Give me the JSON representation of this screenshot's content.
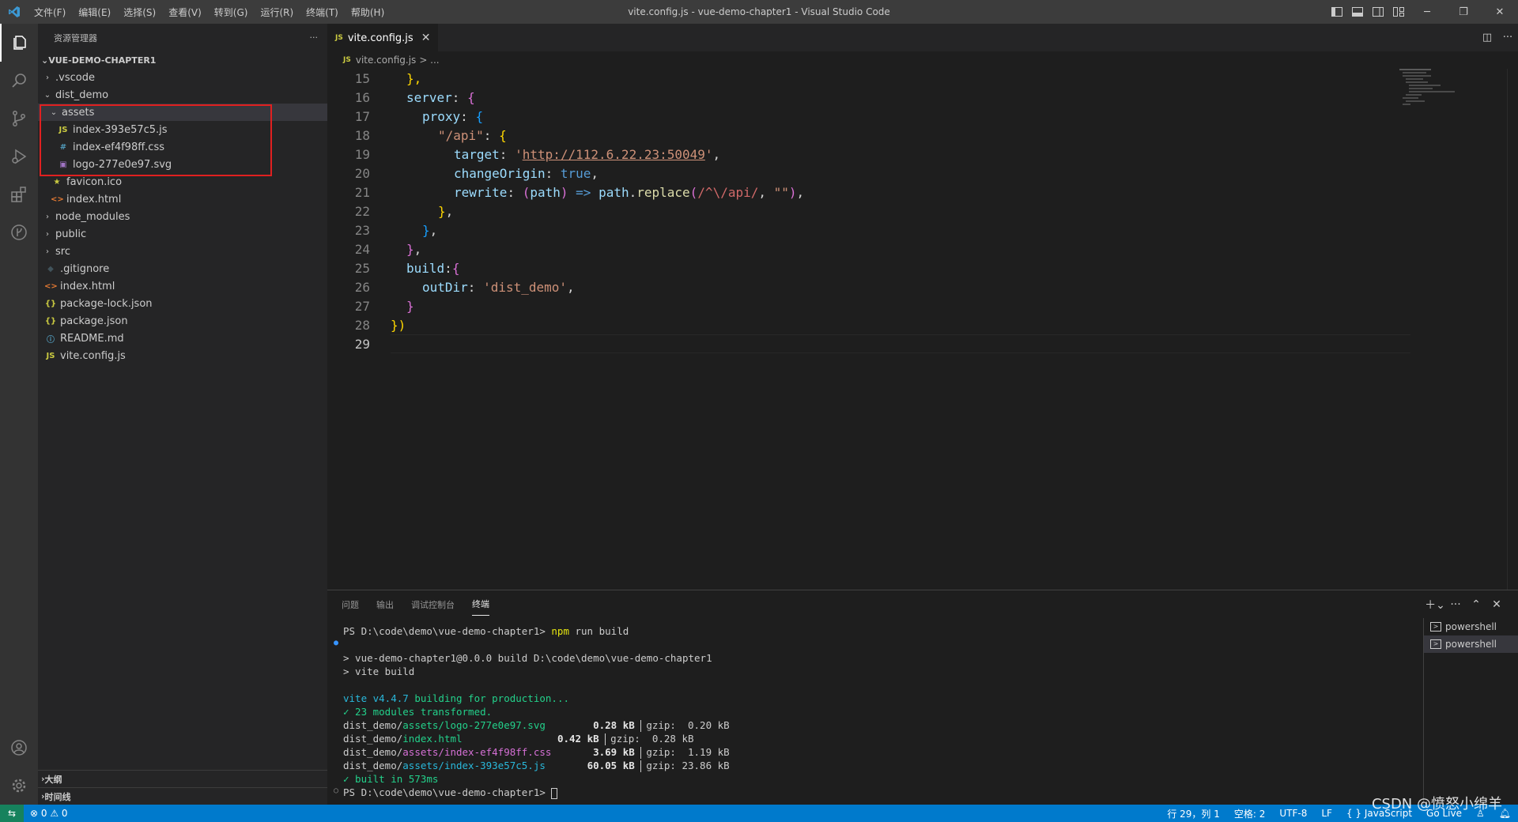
{
  "titlebar": {
    "menu": [
      "文件(F)",
      "编辑(E)",
      "选择(S)",
      "查看(V)",
      "转到(G)",
      "运行(R)",
      "终端(T)",
      "帮助(H)"
    ],
    "title": "vite.config.js - vue-demo-chapter1 - Visual Studio Code"
  },
  "activity_icons": [
    "files-icon",
    "search-icon",
    "source-control-icon",
    "run-debug-icon",
    "extensions-icon",
    "remote-icon"
  ],
  "sidebar": {
    "header": "资源管理器",
    "more": "···",
    "project": "VUE-DEMO-CHAPTER1",
    "tree": [
      {
        "label": ".vscode",
        "type": "folder",
        "depth": 1,
        "open": false
      },
      {
        "label": "dist_demo",
        "type": "folder",
        "depth": 1,
        "open": true
      },
      {
        "label": "assets",
        "type": "folder",
        "depth": 2,
        "open": true,
        "selected": true
      },
      {
        "label": "index-393e57c5.js",
        "type": "js",
        "depth": 3
      },
      {
        "label": "index-ef4f98ff.css",
        "type": "css",
        "depth": 3
      },
      {
        "label": "logo-277e0e97.svg",
        "type": "svg",
        "depth": 3
      },
      {
        "label": "favicon.ico",
        "type": "ico",
        "depth": 2
      },
      {
        "label": "index.html",
        "type": "html",
        "depth": 2
      },
      {
        "label": "node_modules",
        "type": "folder",
        "depth": 1,
        "open": false
      },
      {
        "label": "public",
        "type": "folder",
        "depth": 1,
        "open": false
      },
      {
        "label": "src",
        "type": "folder",
        "depth": 1,
        "open": false
      },
      {
        "label": ".gitignore",
        "type": "git",
        "depth": 1
      },
      {
        "label": "index.html",
        "type": "html",
        "depth": 1
      },
      {
        "label": "package-lock.json",
        "type": "json",
        "depth": 1
      },
      {
        "label": "package.json",
        "type": "json",
        "depth": 1
      },
      {
        "label": "README.md",
        "type": "md",
        "depth": 1
      },
      {
        "label": "vite.config.js",
        "type": "js",
        "depth": 1
      }
    ],
    "outline": "大纲",
    "timeline": "时间线"
  },
  "editor": {
    "tab": "vite.config.js",
    "tab_icon": "JS",
    "breadcrumb_file": "vite.config.js",
    "breadcrumb_rest": "> ...",
    "line_numbers": [
      "15",
      "16",
      "17",
      "18",
      "19",
      "20",
      "21",
      "22",
      "23",
      "24",
      "25",
      "26",
      "27",
      "28",
      "29"
    ],
    "code": {
      "l15": "},",
      "l16_key": "server",
      "l17_key": "proxy",
      "l18_key": "\"/api\"",
      "l19_key": "target",
      "l19_val": "http://112.6.22.23:50049",
      "l20_key": "changeOrigin",
      "l20_val": "true",
      "l21_key": "rewrite",
      "l21_param": "path",
      "l21_obj": "path",
      "l21_fn": "replace",
      "l21_regex": "/^\\/api/",
      "l21_str": "\"\"",
      "l25_key": "build",
      "l26_key": "outDir",
      "l26_val": "'dist_demo'"
    }
  },
  "panel": {
    "tabs": [
      "问题",
      "输出",
      "调试控制台",
      "终端"
    ],
    "active_tab": "终端",
    "terminal": {
      "prompt1": "PS D:\\code\\demo\\vue-demo-chapter1> ",
      "cmd": "npm",
      "cmd_rest": " run build",
      "build1": "> vue-demo-chapter1@0.0.0 build D:\\code\\demo\\vue-demo-chapter1",
      "build2": "> vite build",
      "vite": "vite v4.4.7",
      "vite_rest": " building for production...",
      "modules": "✓ 23 modules transformed.",
      "files": [
        {
          "dir": "dist_demo/",
          "name": "assets/logo-277e0e97.svg",
          "color": "g",
          "pad": "        ",
          "size": "0.28 kB",
          "gzip": "gzip:  0.20 kB"
        },
        {
          "dir": "dist_demo/",
          "name": "index.html",
          "color": "g",
          "pad": "                ",
          "size": "0.42 kB",
          "gzip": "gzip:  0.28 kB"
        },
        {
          "dir": "dist_demo/",
          "name": "assets/index-ef4f98ff.css",
          "color": "mg",
          "pad": "       ",
          "size": "3.69 kB",
          "gzip": "gzip:  1.19 kB"
        },
        {
          "dir": "dist_demo/",
          "name": "assets/index-393e57c5.js",
          "color": "cy",
          "pad": "       ",
          "size": "60.05 kB",
          "gzip": "gzip: 23.86 kB"
        }
      ],
      "built": "✓ built in 573ms",
      "prompt2": "PS D:\\code\\demo\\vue-demo-chapter1> "
    },
    "terminals": [
      "powershell",
      "powershell"
    ]
  },
  "statusbar": {
    "errors": "⊗ 0 ⚠ 0",
    "position": "行 29，列 1",
    "spaces": "空格: 2",
    "encoding": "UTF-8",
    "eol": "LF",
    "language": "{ } JavaScript",
    "golive": "Go Live"
  },
  "watermark": "CSDN @愤怒小绵羊"
}
